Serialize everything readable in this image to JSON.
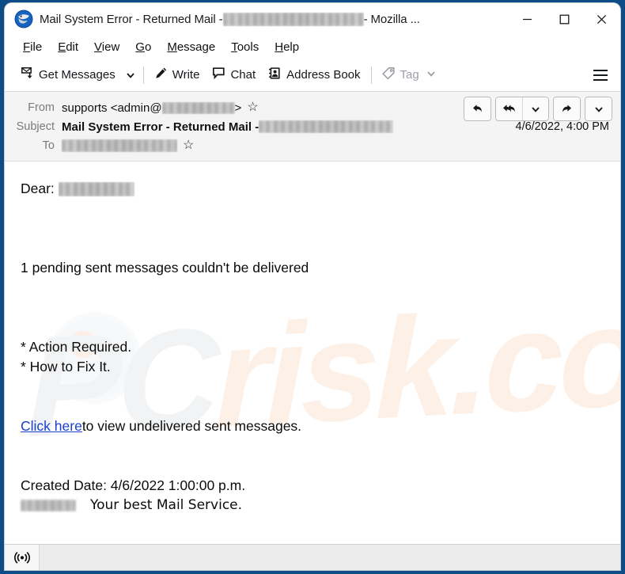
{
  "window": {
    "title_prefix": "Mail System Error - Returned Mail - ",
    "title_suffix": " - Mozilla ...",
    "app_icon": "thunderbird-icon",
    "controls": {
      "minimize": "minimize-icon",
      "maximize": "maximize-icon",
      "close": "close-icon"
    }
  },
  "menubar": {
    "items": [
      {
        "accel": "F",
        "rest": "ile"
      },
      {
        "accel": "E",
        "rest": "dit"
      },
      {
        "accel": "V",
        "rest": "iew"
      },
      {
        "accel": "G",
        "rest": "o"
      },
      {
        "accel": "M",
        "rest": "essage"
      },
      {
        "accel": "T",
        "rest": "ools"
      },
      {
        "accel": "H",
        "rest": "elp"
      }
    ]
  },
  "toolbar": {
    "get_messages_label": "Get Messages",
    "write_label": "Write",
    "chat_label": "Chat",
    "address_book_label": "Address Book",
    "tag_label": "Tag",
    "app_menu_label": "app-menu"
  },
  "message_header": {
    "from_label": "From",
    "from_value": "supports <admin@",
    "from_value_suffix": ">",
    "subject_label": "Subject",
    "subject_value": "Mail System Error - Returned Mail - ",
    "to_label": "To",
    "date": "4/6/2022, 4:00 PM",
    "actions": {
      "reply": "reply-icon",
      "reply_all": "reply-all-icon",
      "reply_all_more": "chevron-down-icon",
      "forward": "forward-icon",
      "more": "chevron-down-icon"
    }
  },
  "body": {
    "greeting": "Dear:",
    "notice": "1 pending sent messages couldn't be delivered",
    "bullet_1": "* Action Required.",
    "bullet_2": "* How to Fix It.",
    "link_text": "Click here",
    "link_rest": " to view undelivered sent messages.",
    "created_date": "Created Date: 4/6/2022 1:00:00 p.m.",
    "signature": "Your best Mail Service.",
    "watermark_pc": "PC",
    "watermark_risk": "risk.com"
  },
  "statusbar": {
    "online_icon": "online-status-icon",
    "status_text": ""
  },
  "colors": {
    "window_frame": "#0d4c87",
    "link": "#1a3fd0",
    "header_bg": "#f4f4f4",
    "statusbar_bg": "#ececec",
    "disabled_text": "#9aa0a6"
  }
}
